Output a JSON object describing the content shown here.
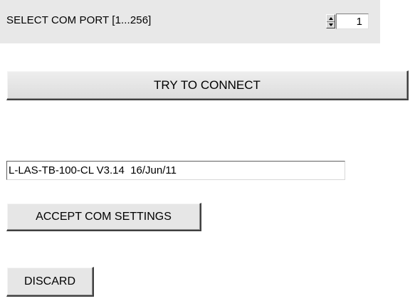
{
  "com_port": {
    "label": "SELECT COM PORT [1...256]",
    "value": "1"
  },
  "connect_button": {
    "label": "TRY TO CONNECT"
  },
  "firmware": {
    "text": "L-LAS-TB-100-CL V3.14  16/Jun/11"
  },
  "accept_button": {
    "label": "ACCEPT COM SETTINGS"
  },
  "discard_button": {
    "label": "DISCARD"
  }
}
